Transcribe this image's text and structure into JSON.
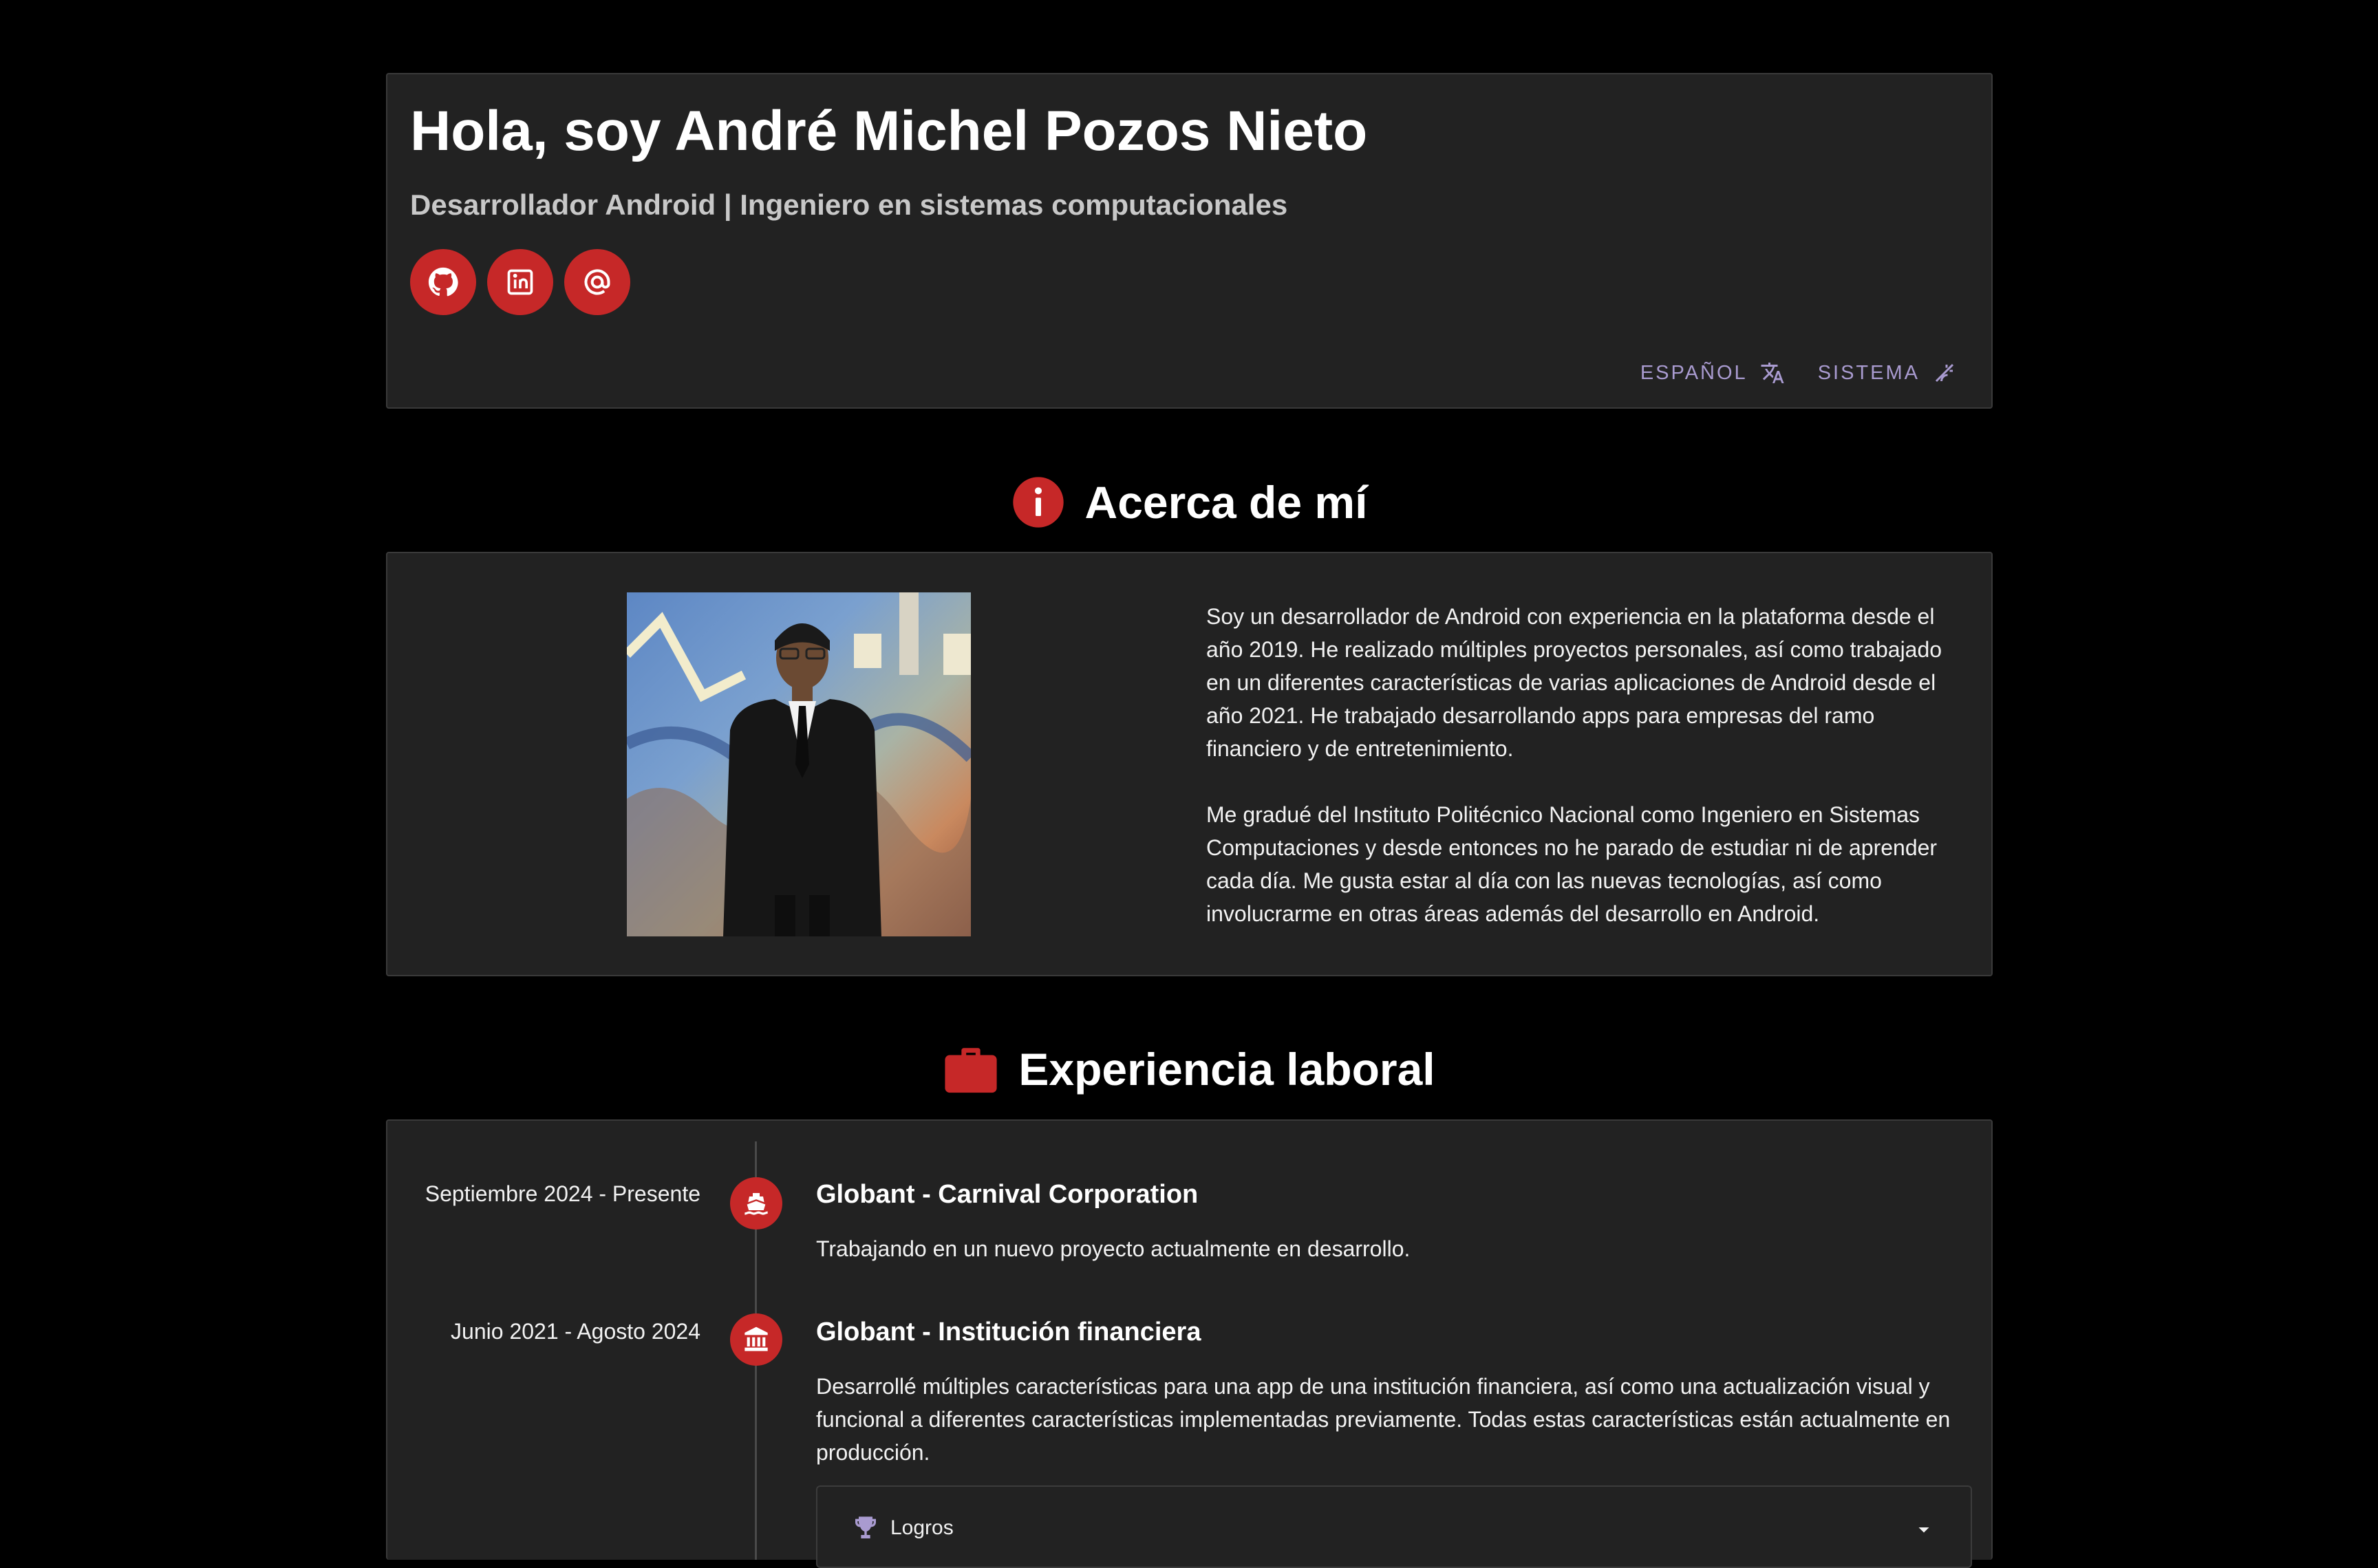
{
  "header": {
    "title": "Hola, soy André Michel Pozos Nieto",
    "subtitle": "Desarrollador Android | Ingeniero en sistemas computacionales",
    "social": [
      {
        "icon": "github-icon"
      },
      {
        "icon": "linkedin-icon"
      },
      {
        "icon": "at-sign-icon"
      }
    ],
    "language_label": "ESPAÑOL",
    "theme_label": "SISTEMA"
  },
  "about": {
    "heading": "Acerca de mí",
    "paragraphs": [
      "Soy un desarrollador de Android con experiencia en la plataforma desde el año 2019. He realizado múltiples proyectos personales, así como trabajado en un diferentes características de varias aplicaciones de Android desde el año 2021. He trabajado desarrollando apps para empresas del ramo financiero y de entretenimiento.",
      "Me gradué del Instituto Politécnico Nacional como Ingeniero en Sistemas Computaciones y desde entonces no he parado de estudiar ni de aprender cada día. Me gusta estar al día con las nuevas tecnologías, así como involucrarme en otras áreas además del desarrollo en Android."
    ]
  },
  "experience": {
    "heading": "Experiencia laboral",
    "items": [
      {
        "date": "Septiembre 2024 - Presente",
        "title": "Globant - Carnival Corporation",
        "description": "Trabajando en un nuevo proyecto actualmente en desarrollo.",
        "icon": "ship-icon"
      },
      {
        "date": "Junio 2021 - Agosto 2024",
        "title": "Globant - Institución financiera",
        "description": "Desarrollé múltiples características para una app de una institución financiera, así como una actualización visual y funcional a diferentes características implementadas previamente. Todas estas características están actualmente en producción.",
        "icon": "bank-icon",
        "achievements_label": "Logros"
      }
    ]
  },
  "colors": {
    "accent": "#c62828",
    "card_bg": "#222222",
    "page_bg": "#000000",
    "pref_text": "#a99bd0"
  }
}
